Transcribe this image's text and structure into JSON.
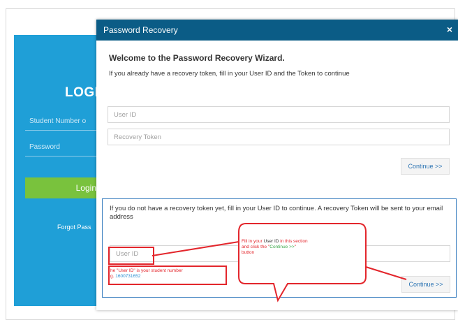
{
  "login": {
    "title": "LOGI",
    "username_placeholder": "Student Number o",
    "password_placeholder": "Password",
    "login_button": "Login",
    "forgot_link": "Forgot Pass"
  },
  "modal": {
    "title": "Password Recovery",
    "close_label": "×",
    "welcome": "Welcome to the Password Recovery Wizard.",
    "intro": "If you already have a recovery token, fill in your User ID and the Token to continue",
    "user_id_placeholder": "User ID",
    "token_placeholder": "Recovery Token",
    "continue_label": "Continue >>",
    "section2": {
      "text": "If you do not have a recovery token yet, fill in your User ID to continue. A recovery Token will be sent to your email address",
      "user_id_placeholder": "User ID",
      "continue_label": "Continue >>"
    }
  },
  "annotations": {
    "callout_line1_a": "Fill in your ",
    "callout_line1_b": "User ID",
    "callout_line1_c": " in this section",
    "callout_line2_a": "and click the \"",
    "callout_line2_b": "Continue >>",
    "callout_line2_c": "\"",
    "callout_line3": "button",
    "note_line1": "he \"User ID\" is your student number",
    "note_line2_a": "g. ",
    "note_line2_b": "1600731652"
  },
  "colors": {
    "header": "#0b5c86",
    "login_card": "#1f9fd7",
    "login_button": "#79c23d",
    "annotation": "#e3262c"
  }
}
